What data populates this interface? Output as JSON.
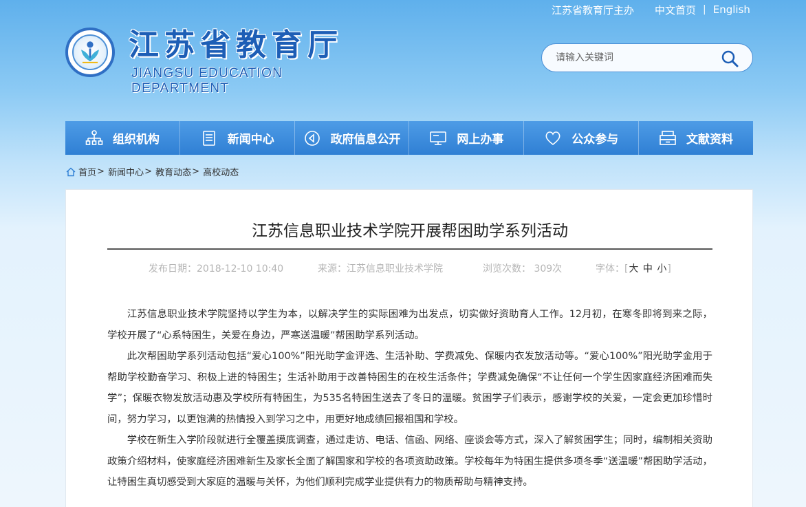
{
  "top_links": {
    "host": "江苏省教育厅主办",
    "home_cn": "中文首页",
    "separator": "|",
    "english": "English"
  },
  "site": {
    "title": "江苏省教育厅",
    "subtitle": "JIANGSU EDUCATION DEPARTMENT"
  },
  "search": {
    "placeholder": "请输入关键词"
  },
  "nav": {
    "items": [
      {
        "label": "组织机构",
        "icon": "org-chart-icon"
      },
      {
        "label": "新闻中心",
        "icon": "news-icon"
      },
      {
        "label": "政府信息公开",
        "icon": "gov-info-icon"
      },
      {
        "label": "网上办事",
        "icon": "monitor-icon"
      },
      {
        "label": "公众参与",
        "icon": "heart-icon"
      },
      {
        "label": "文献资料",
        "icon": "archive-icon"
      }
    ]
  },
  "breadcrumb": {
    "items": [
      "首页",
      "新闻中心",
      "教育动态",
      "高校动态"
    ],
    "separator": ">"
  },
  "article": {
    "title": "江苏信息职业技术学院开展帮困助学系列活动",
    "meta": {
      "date": "发布日期：2018-12-10 10:40",
      "source": "来源：江苏信息职业技术学院",
      "views": "浏览次数： 309次",
      "font_label": "字体：",
      "font_open": "[",
      "font_large": "大",
      "font_medium": "中",
      "font_small": "小",
      "font_close": "]"
    },
    "paragraphs": [
      "江苏信息职业技术学院坚持以学生为本，以解决学生的实际困难为出发点，切实做好资助育人工作。12月初，在寒冬即将到来之际，学校开展了“心系特困生，关爱在身边，严寒送温暖”帮困助学系列活动。",
      "此次帮困助学系列活动包括“爱心100%”阳光助学金评选、生活补助、学费减免、保暖内衣发放活动等。“爱心100%”阳光助学金用于帮助学校勤奋学习、积极上进的特困生；生活补助用于改善特困生的在校生活条件；学费减免确保“不让任何一个学生因家庭经济困难而失学”；保暖衣物发放活动惠及学校所有特困生，为535名特困生送去了冬日的温暖。贫困学子们表示，感谢学校的关爱，一定会更加珍惜时间，努力学习，以更饱满的热情投入到学习之中，用更好地成绩回报祖国和学校。",
      "学校在新生入学阶段就进行全覆盖摸底调查，通过走访、电话、信函、网络、座谈会等方式，深入了解贫困学生；同时，编制相关资助政策介绍材料，使家庭经济困难新生及家长全面了解国家和学校的各项资助政策。学校每年为特困生提供多项冬季“送温暖”帮困助学活动，让特困生真切感受到大家庭的温暖与关怀，为他们顺利完成学业提供有力的物质帮助与精神支持。"
    ]
  },
  "colors": {
    "brand_blue": "#1d5eb6",
    "nav_blue": "#2f7fd4",
    "text": "#333333",
    "meta_gray": "#b5b5b5"
  }
}
